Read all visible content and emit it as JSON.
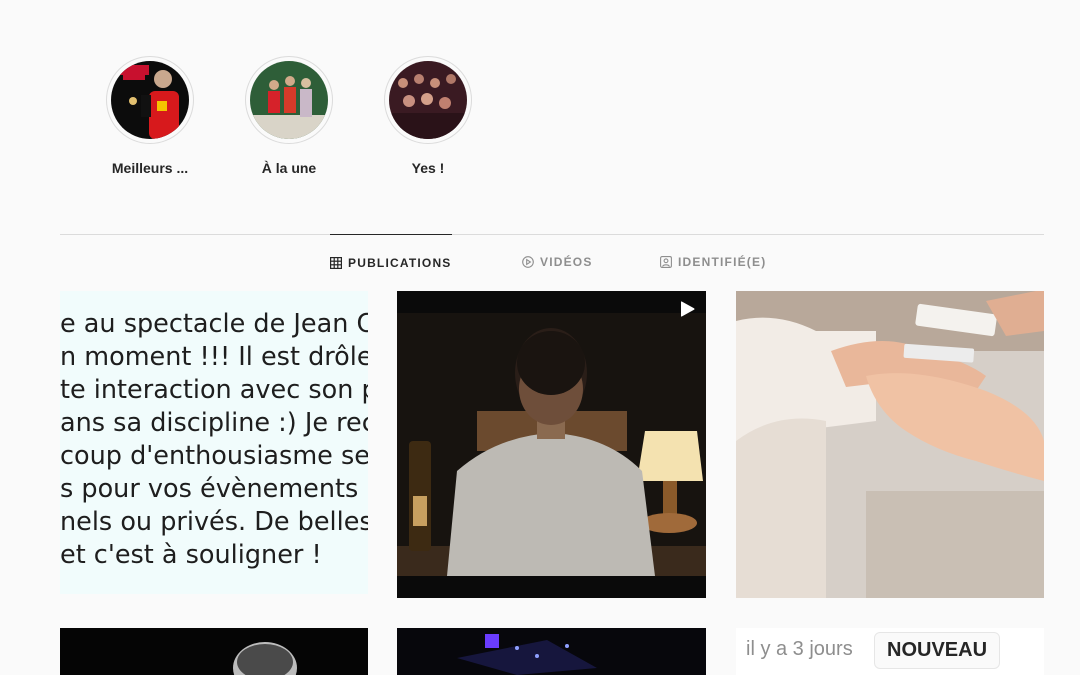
{
  "highlights": [
    {
      "label": "Meilleurs ...",
      "icon": "highlight-performer-red-shirt"
    },
    {
      "label": "À la une",
      "icon": "highlight-group-photo"
    },
    {
      "label": "Yes !",
      "icon": "highlight-audience-photo"
    }
  ],
  "tabs": [
    {
      "label": "PUBLICATIONS",
      "icon": "grid-icon",
      "active": true
    },
    {
      "label": "VIDÉOS",
      "icon": "play-circle-icon",
      "active": false
    },
    {
      "label": "IDENTIFIÉ(E)",
      "icon": "tagged-person-icon",
      "active": false
    }
  ],
  "posts": {
    "review_text_lines": [
      "e au spectacle de Jean C",
      "n moment !!! Il est drôle, e",
      "te interaction avec son pu",
      "ans sa discipline :) Je rec",
      "coup d'enthousiasme ses",
      "s pour vos évènements",
      "nels ou privés. De belles",
      " et c'est à souligner !"
    ],
    "video_post_icon": "play-icon",
    "recent_time": "il y a 3 jours",
    "recent_badge": "NOUVEAU"
  },
  "colors": {
    "background": "#fafafa",
    "text_primary": "#262626",
    "text_secondary": "#8e8e8e",
    "divider": "#dbdbdb"
  }
}
